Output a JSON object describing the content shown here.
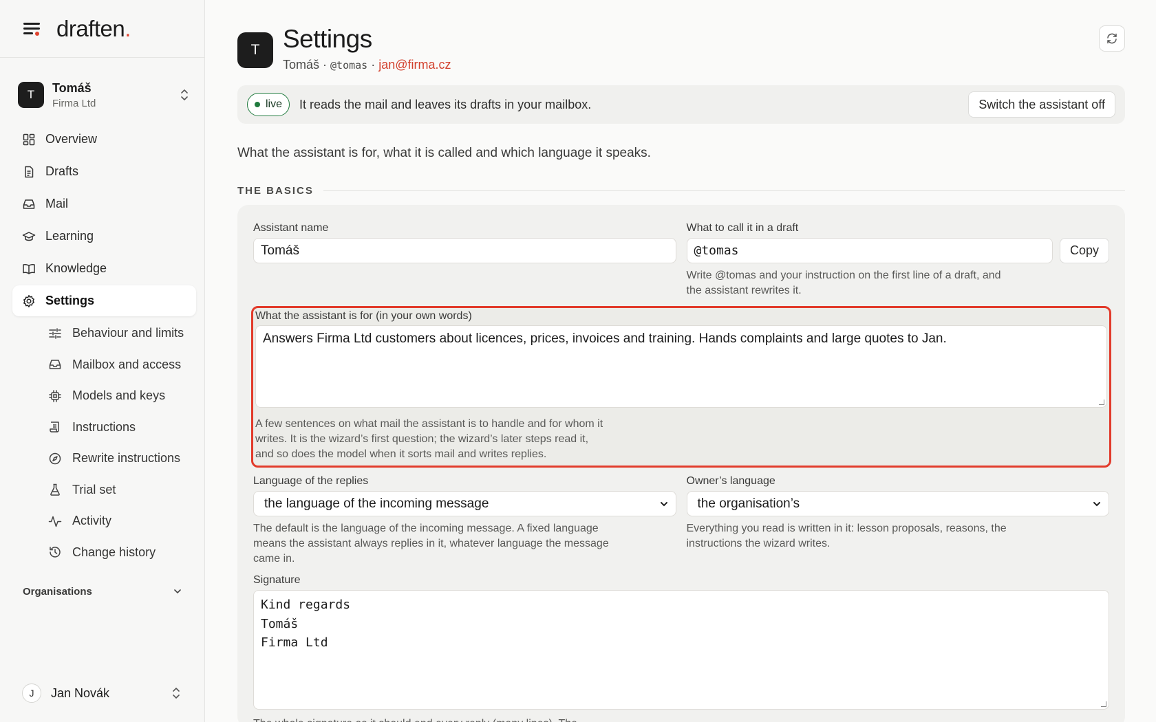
{
  "brand": {
    "name": "draften",
    "dot": "."
  },
  "assistant": {
    "initial": "T",
    "name": "Tomáš",
    "org": "Firma Ltd"
  },
  "nav": [
    {
      "label": "Overview",
      "icon": "grid-icon"
    },
    {
      "label": "Drafts",
      "icon": "document-icon"
    },
    {
      "label": "Mail",
      "icon": "inbox-icon"
    },
    {
      "label": "Learning",
      "icon": "graduation-cap-icon"
    },
    {
      "label": "Knowledge",
      "icon": "book-icon"
    },
    {
      "label": "Settings",
      "icon": "gear-icon",
      "active": true
    }
  ],
  "settings_sub": [
    {
      "label": "Behaviour and limits",
      "icon": "sliders-icon"
    },
    {
      "label": "Mailbox and access",
      "icon": "inbox-icon"
    },
    {
      "label": "Models and keys",
      "icon": "chip-icon"
    },
    {
      "label": "Instructions",
      "icon": "scroll-icon"
    },
    {
      "label": "Rewrite instructions",
      "icon": "compass-icon"
    },
    {
      "label": "Trial set",
      "icon": "flask-icon"
    },
    {
      "label": "Activity",
      "icon": "activity-icon"
    },
    {
      "label": "Change history",
      "icon": "history-icon"
    }
  ],
  "organisations": {
    "label": "Organisations"
  },
  "user": {
    "initial": "J",
    "name": "Jan Novák"
  },
  "header": {
    "initial": "T",
    "title": "Settings",
    "name": "Tomáš",
    "sep1": " · ",
    "handle": "@tomas",
    "sep2": " · ",
    "email": "jan@firma.cz"
  },
  "status": {
    "badge": "live",
    "text": "It reads the mail and leaves its drafts in your mailbox.",
    "button": "Switch the assistant off",
    "accent": "#1f7a3d"
  },
  "intro": "What the assistant is for, what it is called and which language it speaks.",
  "section": {
    "title": "THE BASICS"
  },
  "form": {
    "assistant_name": {
      "label": "Assistant name",
      "value": "Tomáš"
    },
    "call_name": {
      "label": "What to call it in a draft",
      "value": "@tomas",
      "copy": "Copy",
      "help": "Write @tomas and your instruction on the first line of a draft, and the assistant rewrites it."
    },
    "purpose": {
      "label": "What the assistant is for (in your own words)",
      "value": "Answers Firma Ltd customers about licences, prices, invoices and training. Hands complaints and large quotes to Jan.",
      "help": "A few sentences on what mail the assistant is to handle and for whom it writes. It is the wizard’s first question; the wizard’s later steps read it, and so does the model when it sorts mail and writes replies."
    },
    "reply_language": {
      "label": "Language of the replies",
      "value": "the language of the incoming message",
      "help": "The default is the language of the incoming message. A fixed language means the assistant always replies in it, whatever language the message came in."
    },
    "owner_language": {
      "label": "Owner’s language",
      "value": "the organisation’s",
      "help": "Everything you read is written in it: lesson proposals, reasons, the instructions the wizard writes."
    },
    "signature": {
      "label": "Signature",
      "lines": [
        "Kind regards",
        "Tomáš",
        "Firma Ltd"
      ],
      "help": "The whole signature as it should end every reply (many lines). The"
    }
  },
  "colors": {
    "highlight": "#e23b2b",
    "brand_dot": "#e0432f",
    "email": "#d2402d"
  }
}
